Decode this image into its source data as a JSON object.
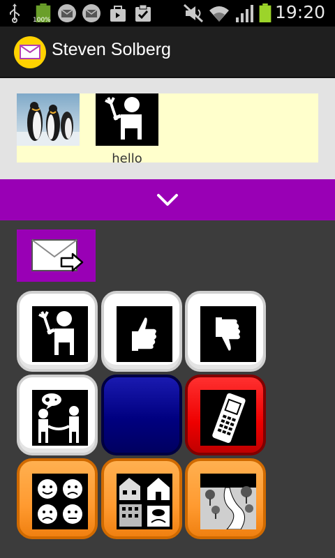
{
  "status_bar": {
    "time": "19:20",
    "battery_percent_label": "100%",
    "left_icons": [
      "usb-icon",
      "battery-full-icon",
      "mail-notification-icon",
      "mail-notification-icon",
      "bag-icon",
      "clipboard-check-icon"
    ],
    "right_icons": [
      "mute-icon",
      "wifi-icon",
      "signal-icon",
      "battery-icon"
    ]
  },
  "action_bar": {
    "title": "Steven Solberg",
    "app_icon": "envelope-app-icon"
  },
  "message_strip": {
    "items": [
      {
        "kind": "photo",
        "icon": "penguins-photo",
        "label": ""
      },
      {
        "kind": "symbol",
        "icon": "hello-wave-icon",
        "label": "hello"
      }
    ]
  },
  "collapse_bar": {
    "icon": "chevron-down-icon"
  },
  "send_button": {
    "icon": "send-envelope-icon"
  },
  "tiles": [
    {
      "icon": "hello-wave-icon",
      "style": "white"
    },
    {
      "icon": "thumbs-up-icon",
      "style": "white"
    },
    {
      "icon": "thumbs-down-icon",
      "style": "white"
    },
    {
      "icon": "conversation-icon",
      "style": "white"
    },
    {
      "icon": "blank-tile",
      "style": "navy"
    },
    {
      "icon": "mobile-phone-icon",
      "style": "red"
    },
    {
      "icon": "feelings-faces-icon",
      "style": "orange"
    },
    {
      "icon": "places-icon",
      "style": "orange"
    },
    {
      "icon": "outdoors-path-icon",
      "style": "orange"
    }
  ],
  "colors": {
    "accent_purple": "#9900b5",
    "strip_yellow": "#ffffcc",
    "tile_white": "#ffffff",
    "tile_navy": "#000080",
    "tile_red": "#ee0000",
    "tile_orange": "#ff9a30",
    "app_icon_yellow": "#ffd200"
  }
}
